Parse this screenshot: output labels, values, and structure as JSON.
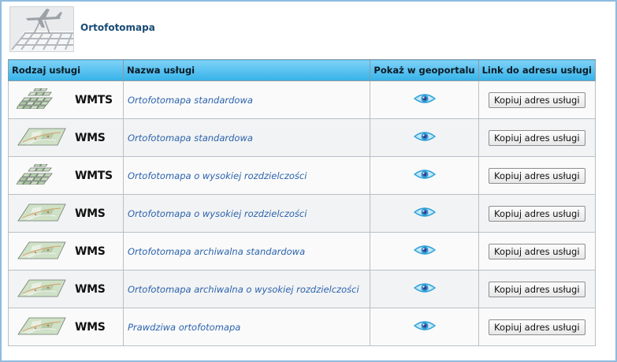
{
  "section": {
    "title": "Ortofotomapa"
  },
  "table": {
    "headers": [
      "Rodzaj usługi",
      "Nazwa usługi",
      "Pokaż w geoportalu",
      "Link do adresu usługi"
    ],
    "rows": [
      {
        "type": "WMTS",
        "name": "Ortofotomapa standardowa",
        "button": "Kopiuj adres usługi"
      },
      {
        "type": "WMS",
        "name": "Ortofotomapa standardowa",
        "button": "Kopiuj adres usługi"
      },
      {
        "type": "WMTS",
        "name": "Ortofotomapa o wysokiej rozdzielczości",
        "button": "Kopiuj adres usługi"
      },
      {
        "type": "WMS",
        "name": "Ortofotomapa o wysokiej rozdzielczości",
        "button": "Kopiuj adres usługi"
      },
      {
        "type": "WMS",
        "name": "Ortofotomapa archiwalna standardowa",
        "button": "Kopiuj adres usługi"
      },
      {
        "type": "WMS",
        "name": "Ortofotomapa archiwalna o wysokiej rozdzielczości",
        "button": "Kopiuj adres usługi"
      },
      {
        "type": "WMS",
        "name": "Prawdziwa ortofotomapa",
        "button": "Kopiuj adres usługi"
      }
    ]
  },
  "icons": {
    "header_thumb": "aerial-photo-plane-icon",
    "type_wmts": "wmts-tiles-icon",
    "type_wms": "wms-map-sheet-icon",
    "show": "eye-icon"
  },
  "colors": {
    "header_gradient_top": "#7fd2f7",
    "header_gradient_bottom": "#36b2e8",
    "link": "#2b63ad",
    "title": "#1a4b73"
  }
}
